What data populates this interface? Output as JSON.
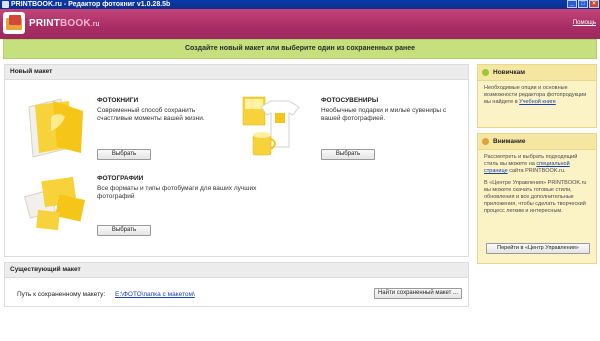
{
  "window": {
    "title": "PRINTBOOK.ru - Редактор фотокниг v1.0.28.5b",
    "minimize": "_",
    "maximize": "□",
    "close": "×"
  },
  "header": {
    "brand_main": "PRINT",
    "brand_accent": "BOOK",
    "brand_domain": ".ru",
    "help": "Помощь"
  },
  "banner": {
    "text": "Создайте новый макет или выберите один из сохраненных ранее"
  },
  "new_layout": {
    "heading": "Новый макет",
    "items": [
      {
        "title": "ФОТОКНИГИ",
        "desc": "Современный способ сохранить счастливые моменты вашей жизни.",
        "button": "Выбрать"
      },
      {
        "title": "ФОТОСУВЕНИРЫ",
        "desc": "Необычные подарки и милые сувениры с вашей фотографией.",
        "button": "Выбрать"
      },
      {
        "title": "ФОТОГРАФИИ",
        "desc": "Все форматы и типы фотобумаги для ваших лучших фотографий",
        "button": "Выбрать"
      }
    ]
  },
  "existing": {
    "heading": "Существующий макет",
    "path_label": "Путь к сохраненному макету:",
    "path_value": "E:\\ФОТО\\папка с макетом\\",
    "find_button": "Найти сохраненный макет ..."
  },
  "side_newbie": {
    "heading": "Новичкам",
    "text": "Необходимые опции и основные возможности редактора фотопродукции вы найдете в",
    "link": "Учебной книге",
    "color": "#9bc63a"
  },
  "side_attention": {
    "heading": "Внимание",
    "text1": "Рассмотреть и выбрать подходящий стиль вы можете на",
    "link": "специальной странице",
    "text1b": "сайта PRINTBOOK.ru.",
    "text2": "В «Центре Управления» PRINTBOOK.ru вы можете скачать готовые стили, обновления и все дополнительные приложения, чтобы сделать творческий процесс легким и интересным.",
    "button": "Перейти в «Центр Управления»",
    "color": "#e0a13a"
  }
}
